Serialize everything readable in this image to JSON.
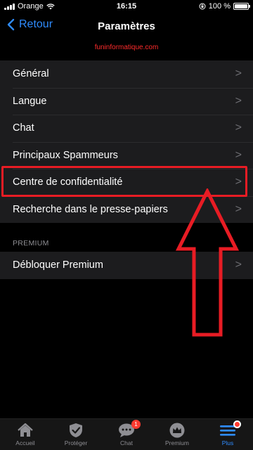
{
  "status": {
    "carrier": "Orange",
    "time": "16:15",
    "battery": "100 %"
  },
  "nav": {
    "back_label": "Retour",
    "title": "Paramètres"
  },
  "watermark": "funinformatique.com",
  "settings": {
    "items": [
      {
        "label": "Général"
      },
      {
        "label": "Langue"
      },
      {
        "label": "Chat"
      },
      {
        "label": "Principaux Spammeurs"
      },
      {
        "label": "Centre de confidentialité"
      },
      {
        "label": "Recherche dans le presse-papiers"
      }
    ]
  },
  "premium": {
    "header": "PREMIUM",
    "items": [
      {
        "label": "Débloquer Premium"
      }
    ]
  },
  "chevron": ">",
  "tabs": [
    {
      "label": "Accueil",
      "icon": "home-icon"
    },
    {
      "label": "Protéger",
      "icon": "shield-icon"
    },
    {
      "label": "Chat",
      "icon": "chat-icon",
      "badge": "1"
    },
    {
      "label": "Premium",
      "icon": "crown-icon"
    },
    {
      "label": "Plus",
      "icon": "menu-icon",
      "active": true
    }
  ],
  "colors": {
    "accent": "#2f8cff",
    "highlight": "#e81c24",
    "badge": "#ff3b30"
  }
}
